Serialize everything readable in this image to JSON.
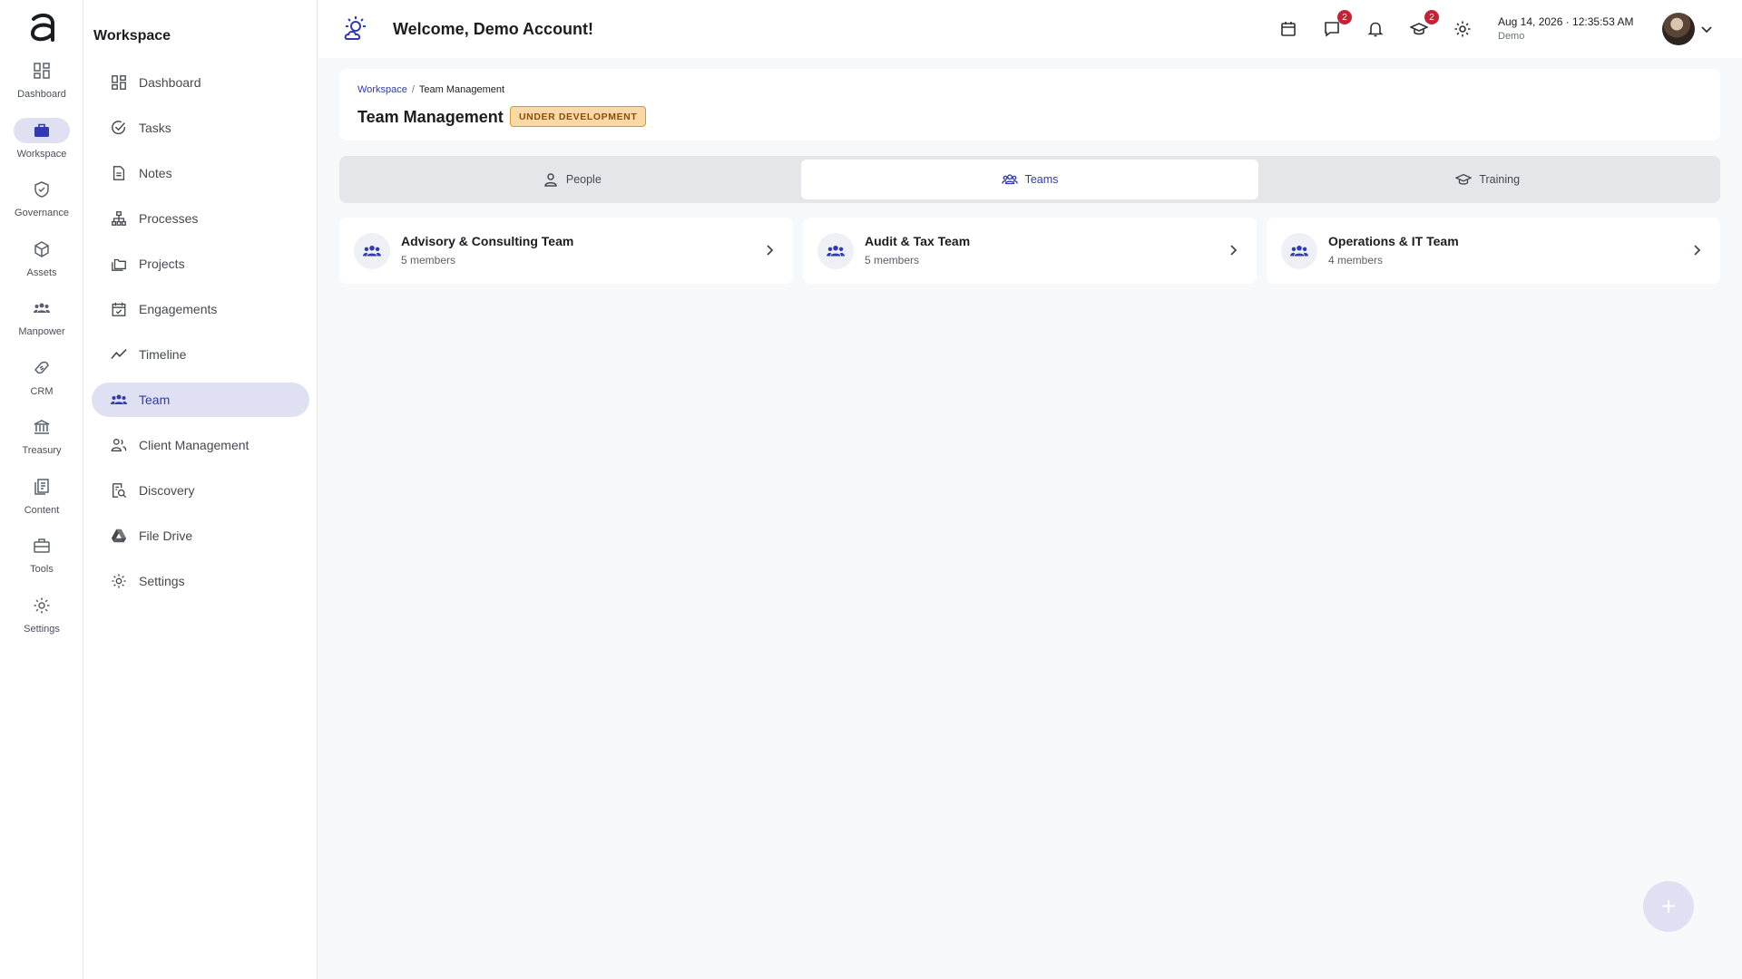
{
  "rail": {
    "items": [
      {
        "label": "Dashboard",
        "icon": "grid-icon"
      },
      {
        "label": "Workspace",
        "icon": "briefcase-icon",
        "active": true
      },
      {
        "label": "Governance",
        "icon": "shield-check-icon"
      },
      {
        "label": "Assets",
        "icon": "cube-icon"
      },
      {
        "label": "Manpower",
        "icon": "people-icon"
      },
      {
        "label": "CRM",
        "icon": "handshake-icon"
      },
      {
        "label": "Treasury",
        "icon": "bank-icon"
      },
      {
        "label": "Content",
        "icon": "documents-icon"
      },
      {
        "label": "Tools",
        "icon": "toolbox-icon"
      },
      {
        "label": "Settings",
        "icon": "gear-icon"
      }
    ]
  },
  "sidenav": {
    "title": "Workspace",
    "items": [
      {
        "label": "Dashboard",
        "icon": "grid-icon"
      },
      {
        "label": "Tasks",
        "icon": "check-circle-icon"
      },
      {
        "label": "Notes",
        "icon": "note-icon"
      },
      {
        "label": "Processes",
        "icon": "hierarchy-icon"
      },
      {
        "label": "Projects",
        "icon": "folders-icon"
      },
      {
        "label": "Engagements",
        "icon": "calendar-check-icon"
      },
      {
        "label": "Timeline",
        "icon": "trend-line-icon"
      },
      {
        "label": "Team",
        "icon": "people-icon",
        "active": true
      },
      {
        "label": "Client Management",
        "icon": "client-icon"
      },
      {
        "label": "Discovery",
        "icon": "search-doc-icon"
      },
      {
        "label": "File Drive",
        "icon": "drive-icon"
      },
      {
        "label": "Settings",
        "icon": "gear-icon"
      }
    ]
  },
  "header": {
    "welcome": "Welcome, Demo Account!",
    "chat_badge": "2",
    "training_badge": "2",
    "datetime": "Aug 14, 2026 · 12:35:53 AM",
    "subtitle": "Demo"
  },
  "page": {
    "breadcrumb_root": "Workspace",
    "breadcrumb_sep": "/",
    "breadcrumb_current": "Team Management",
    "title": "Team Management",
    "status_badge": "UNDER DEVELOPMENT"
  },
  "tabs": [
    {
      "label": "People",
      "icon": "person-icon"
    },
    {
      "label": "Teams",
      "icon": "people-icon",
      "active": true
    },
    {
      "label": "Training",
      "icon": "graduation-cap-icon"
    }
  ],
  "teams": [
    {
      "name": "Advisory & Consulting Team",
      "members": "5 members"
    },
    {
      "name": "Audit & Tax Team",
      "members": "5 members"
    },
    {
      "name": "Operations & IT Team",
      "members": "4 members"
    }
  ],
  "fab": {
    "label": "+"
  },
  "colors": {
    "accent": "#2f3ab3",
    "active_bg": "#dfe1f2",
    "badge": "#c52233",
    "warning_bg": "#fbd9a6"
  }
}
